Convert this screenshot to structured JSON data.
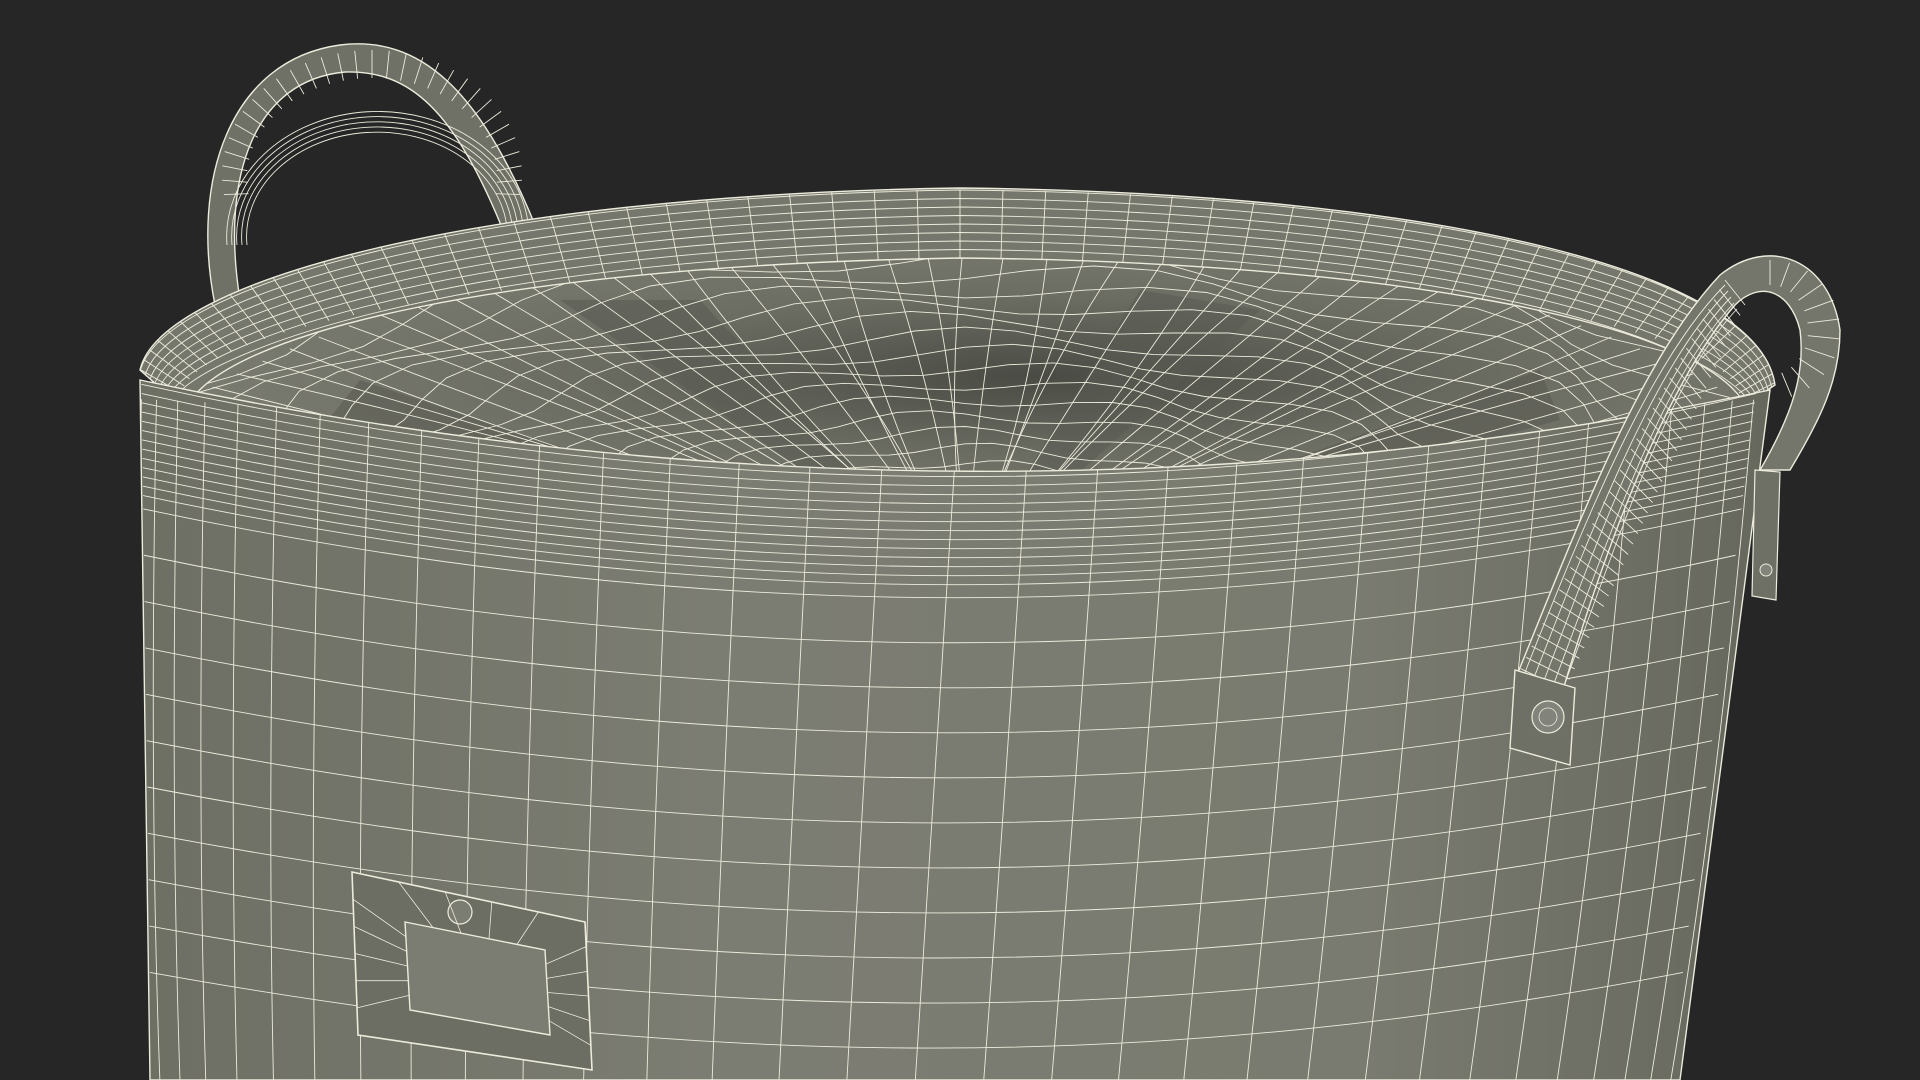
{
  "scene": {
    "subject": "wireframe-laundry-basket",
    "colors": {
      "background": "#262626",
      "fabric": "#7a7b70",
      "fabric_dark": "#55564e",
      "fabric_shadow": "#3d3e38",
      "wire": "#ecebdc"
    }
  }
}
